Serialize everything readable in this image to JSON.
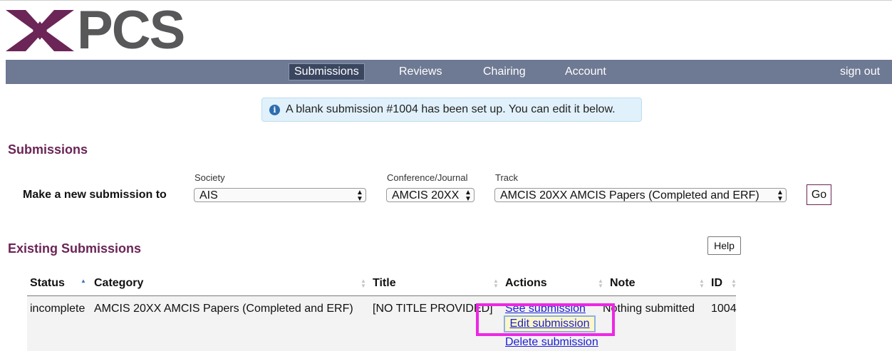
{
  "logo": {
    "text": "PCS",
    "icon": "pcs-star-logo-icon"
  },
  "nav": {
    "items": [
      "Submissions",
      "Reviews",
      "Chairing",
      "Account"
    ],
    "active": "Submissions",
    "sign_out": "sign out"
  },
  "info_message": {
    "icon": "info-icon",
    "icon_glyph": "i",
    "text": "A blank submission #1004 has been set up. You can edit it below."
  },
  "submissions_heading": "Submissions",
  "new_submission": {
    "label": "Make a new submission to",
    "society": {
      "label": "Society",
      "value": "AIS"
    },
    "conference": {
      "label": "Conference/Journal",
      "value": "AMCIS 20XX"
    },
    "track": {
      "label": "Track",
      "value": "AMCIS 20XX AMCIS Papers (Completed and ERF)"
    },
    "go_label": "Go"
  },
  "existing": {
    "heading": "Existing Submissions",
    "help_label": "Help",
    "columns": [
      "Status",
      "Category",
      "Title",
      "Actions",
      "Note",
      "ID"
    ],
    "rows": [
      {
        "status": "incomplete",
        "category": "AMCIS 20XX AMCIS Papers (Completed and ERF)",
        "title": "[NO TITLE PROVIDED]",
        "actions": [
          "See submission",
          "Edit submission",
          "Delete submission"
        ],
        "note": "Nothing submitted",
        "id": "1004"
      }
    ]
  },
  "colors": {
    "nav_bg": "#6e7993",
    "nav_active_bg": "#3a465f",
    "heading": "#6b2556",
    "link": "#1a1fcf",
    "highlight": "#ee27e4",
    "info_bg": "#e1f1fb"
  }
}
